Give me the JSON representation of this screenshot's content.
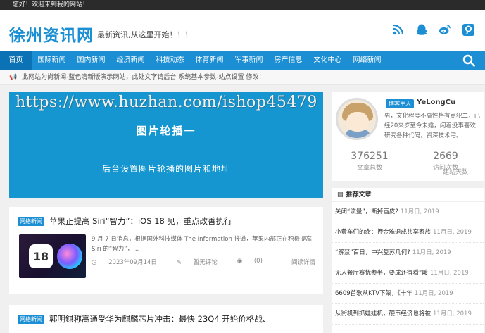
{
  "topbar": {
    "greeting": "您好！欢迎来到我的网站！"
  },
  "header": {
    "logo": "徐州资讯网",
    "slogan": "最新资讯,从这里开始！！！",
    "social_icons": [
      "rss-icon",
      "qq-icon",
      "weibo-icon",
      "pinterest-icon"
    ]
  },
  "nav": {
    "items": [
      "首页",
      "国际新闻",
      "国内新闻",
      "经济新闻",
      "科技动态",
      "体育新闻",
      "军事新闻",
      "房产信息",
      "文化中心",
      "网络新闻"
    ],
    "active_index": 0
  },
  "notice": {
    "text": "此网站为尚新闻-蓝色清新版演示网站，此处文字请后台 系统基本参数-站点设置 修改！"
  },
  "watermark": "https://www.huzhan.com/ishop45479",
  "banner": {
    "title": "图片轮播一",
    "subtitle": "后台设置图片轮播的图片和地址"
  },
  "posts": [
    {
      "tag": "网络新闻",
      "title": "苹果正提高 Siri“智力”：iOS 18 见，重点改善执行",
      "excerpt": "9 月 7 日消息，根据国外科技媒体 The Information 报道，苹果内部正在积极提高 Siri 的“智力”，...",
      "thumb_text": "18",
      "date": "2023年09月14日",
      "comments_label": "暂无评论",
      "views": "(0)",
      "more": "阅读详情"
    },
    {
      "tag": "网络新闻",
      "title": "郭明錤称高通受华为麒麟芯片冲击：最快 23Q4 开始价格战、"
    }
  ],
  "author": {
    "badge": "博客主人",
    "name": "YeLongCu",
    "bio": "男，文化程度不高性格有点犯二，已经20来岁至今未婚，闲着没事喜欢研究各种代码，资深技术宅。",
    "stats": [
      {
        "num": "376251",
        "label": "文章总数"
      },
      {
        "num": "2669",
        "label": "访问次数"
      }
    ],
    "stat_extra_label": "建站天数"
  },
  "recommended": {
    "title": "推荐文章",
    "items": [
      {
        "title": "关闭“流量”，断掉画皮?",
        "date": "11月日, 2019"
      },
      {
        "title": "小黄车们的命：押金难退成共享家族",
        "date": "11月日, 2019"
      },
      {
        "title": "“解禁”百日，中兴复苏几何?",
        "date": "11月日, 2019"
      },
      {
        "title": "无人餐厅赛忧参半，要成还得看“暖",
        "date": "11月日, 2019"
      },
      {
        "title": "6609首歌从KTV下架，《十年",
        "date": "11月日, 2019"
      },
      {
        "title": "从街机到抓娃娃机，硬币经济也将被",
        "date": "11月日, 2019"
      }
    ]
  },
  "colors": {
    "brand": "#1c8fd4",
    "nav_active": "#0b72b5",
    "banner": "#1596d0",
    "topbar": "#2b2b2b"
  }
}
